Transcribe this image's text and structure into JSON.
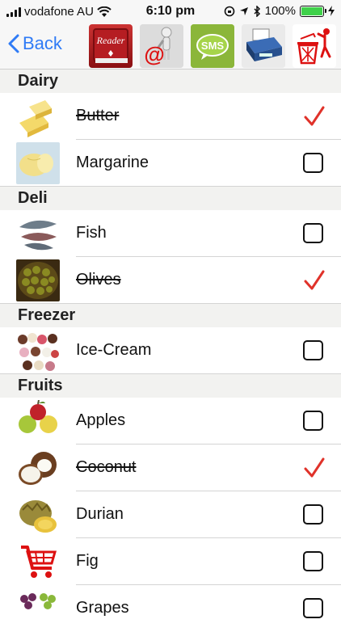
{
  "status_bar": {
    "carrier": "vodafone AU",
    "time": "6:10 pm",
    "battery": "100%"
  },
  "nav": {
    "back_label": "Back",
    "reader_label": "Reader",
    "sms_label": "SMS"
  },
  "sections": [
    {
      "title": "Dairy",
      "items": [
        {
          "label": "Butter",
          "checked": true
        },
        {
          "label": "Margarine",
          "checked": false
        }
      ]
    },
    {
      "title": "Deli",
      "items": [
        {
          "label": "Fish",
          "checked": false
        },
        {
          "label": "Olives",
          "checked": true
        }
      ]
    },
    {
      "title": "Freezer",
      "items": [
        {
          "label": "Ice-Cream",
          "checked": false
        }
      ]
    },
    {
      "title": "Fruits",
      "items": [
        {
          "label": "Apples",
          "checked": false
        },
        {
          "label": "Coconut",
          "checked": true
        },
        {
          "label": "Durian",
          "checked": false
        },
        {
          "label": "Fig",
          "checked": false
        },
        {
          "label": "Grapes",
          "checked": false
        }
      ]
    }
  ],
  "colors": {
    "accent": "#2f7bf6",
    "check": "#e0322a"
  }
}
